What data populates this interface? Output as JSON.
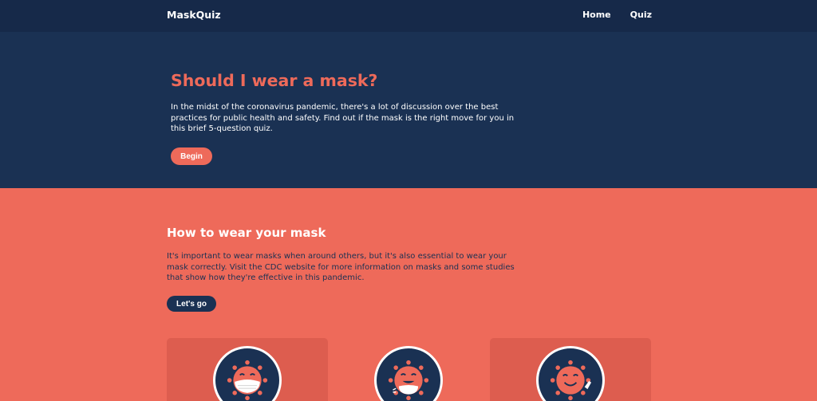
{
  "nav": {
    "brand": "MaskQuiz",
    "links": [
      {
        "label": "Home"
      },
      {
        "label": "Quiz"
      }
    ]
  },
  "hero": {
    "title": "Should I wear a mask?",
    "description": "In the midst of the coronavirus pandemic, there's a lot of discussion over the best practices for public health and safety. Find out if the mask is the right move for you in this brief 5-question quiz.",
    "button_label": "Begin"
  },
  "mask_section": {
    "title": "How to wear your mask",
    "description": "It's important to wear masks when around others, but it's also essential to wear your mask correctly. Visit the CDC website for more information on masks and some studies that show how they're effective in this pandemic.",
    "button_label": "Let's go"
  },
  "cards": [
    {
      "icon": "virus-with-mask-icon"
    },
    {
      "icon": "virus-with-chin-mask-icon"
    },
    {
      "icon": "virus-waving-icon"
    }
  ],
  "colors": {
    "navy": "#1a3153",
    "nav_bg": "#162949",
    "coral": "#ee6a5a",
    "card_bg": "#dd5d4f"
  }
}
